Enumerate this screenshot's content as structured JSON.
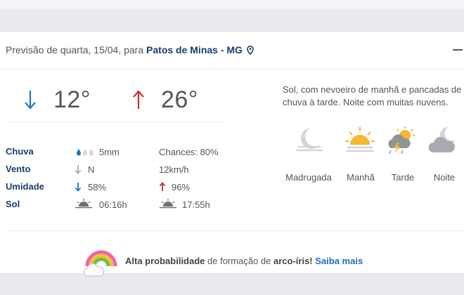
{
  "top_strip": {
    "fragments": [
      "•",
      "•",
      "•"
    ]
  },
  "header": {
    "prefix": "Previsão de quarta, 15/04, para",
    "city": "Patos de Minas - MG",
    "location_icon": "location-pin-icon",
    "collapse_icon": "minus-icon"
  },
  "temperature": {
    "min": "12°",
    "max": "26°",
    "min_arrow": "arrow-down-icon",
    "max_arrow": "arrow-up-icon",
    "min_color": "#1b7ac9",
    "max_color": "#c9302c"
  },
  "details": {
    "chuva": {
      "label": "Chuva",
      "amount": "5mm",
      "chances": "Chances: 80%"
    },
    "vento": {
      "label": "Vento",
      "direction": "N",
      "speed": "12km/h"
    },
    "umidade": {
      "label": "Umidade",
      "min": "58%",
      "max": "96%"
    },
    "sol": {
      "label": "Sol",
      "sunrise": "06:16h",
      "sunset": "17:55h"
    }
  },
  "summary": "Sol, com nevoeiro de manhã e pancadas de chuva à tarde. Noite com muitas nuvens.",
  "periods": [
    {
      "label": "Madrugada",
      "icon": "moon-fog-icon"
    },
    {
      "label": "Manhã",
      "icon": "sun-fog-icon"
    },
    {
      "label": "Tarde",
      "icon": "sun-rain-thunder-icon"
    },
    {
      "label": "Noite",
      "icon": "moon-cloud-icon"
    }
  ],
  "rainbow": {
    "prefix": "Alta probabilidade",
    "middle": "de formação de",
    "bold_end": "arco-íris!",
    "link": "Saiba mais",
    "icon": "rainbow-cloud-icon"
  },
  "colors": {
    "label_blue": "#173e6b",
    "link_blue": "#1f6fb3",
    "icon_gray": "#c9ccd0",
    "sun_yellow": "#f5b82e"
  }
}
